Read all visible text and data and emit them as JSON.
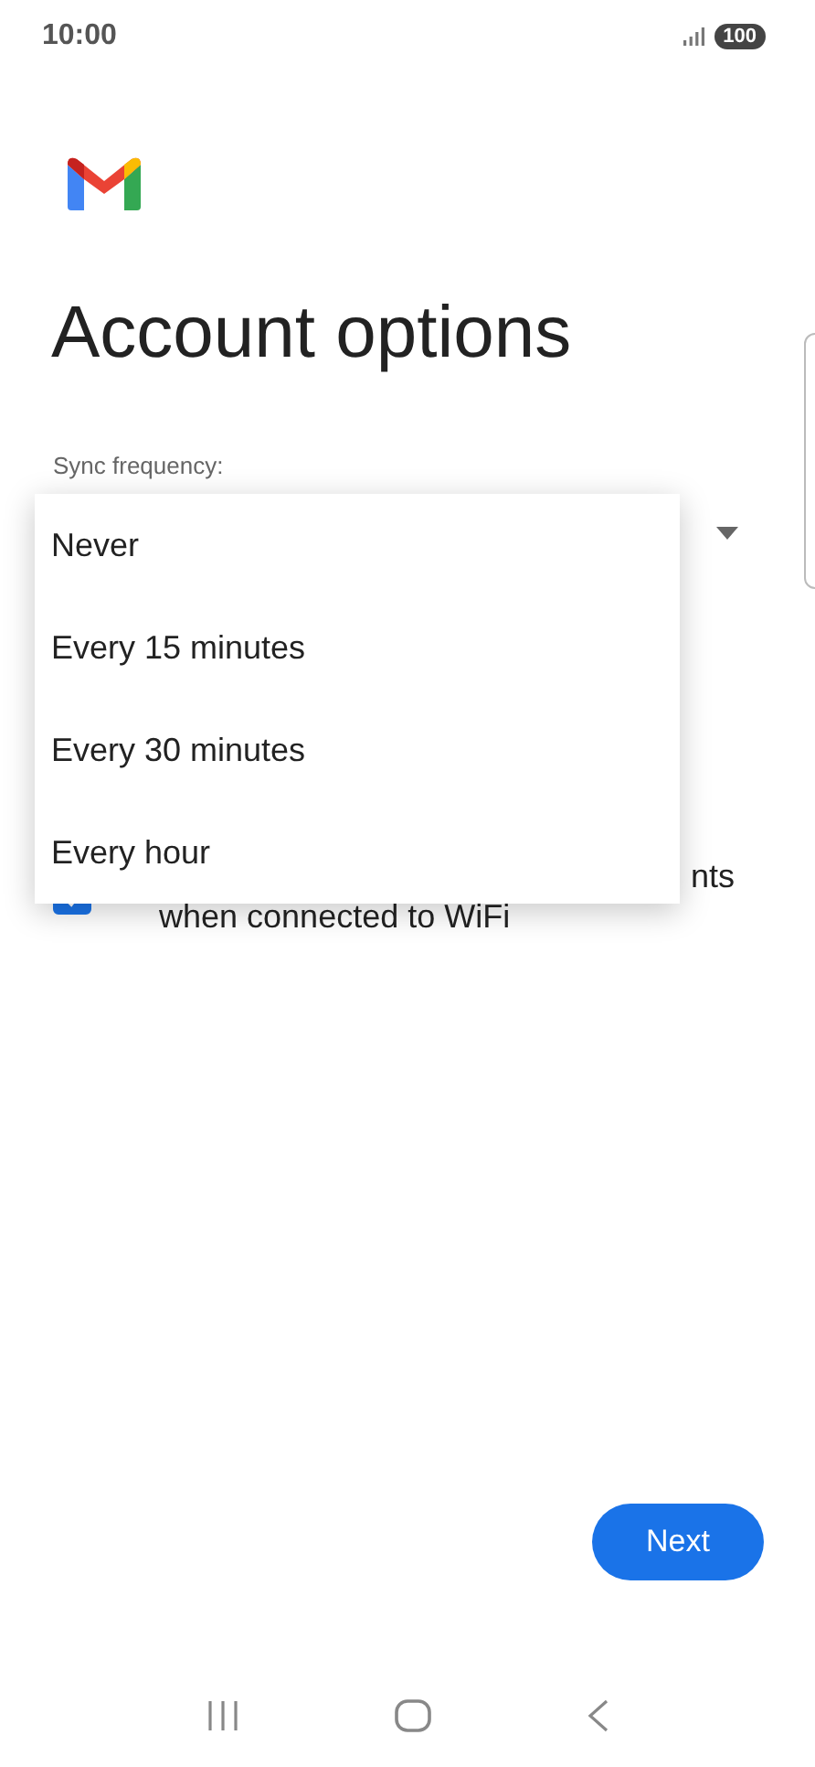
{
  "status_bar": {
    "time": "10:00",
    "battery": "100"
  },
  "title": "Account options",
  "sync": {
    "label": "Sync frequency:"
  },
  "dropdown": {
    "options": [
      {
        "label": "Never"
      },
      {
        "label": "Every 15 minutes"
      },
      {
        "label": "Every 30 minutes"
      },
      {
        "label": "Every hour"
      }
    ]
  },
  "attachments": {
    "checked": true,
    "line_1_end": "nts",
    "line_2": "when connected to WiFi"
  },
  "next_button": "Next"
}
